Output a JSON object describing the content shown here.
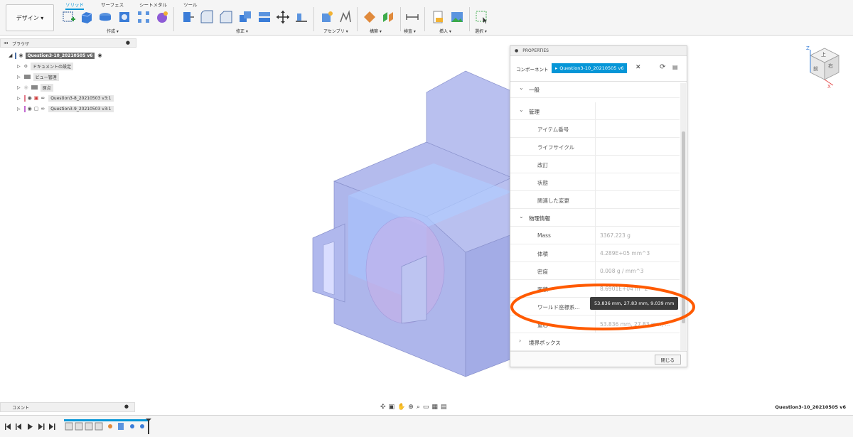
{
  "toolbar": {
    "workspace_label": "デザイン ▾",
    "tabs": [
      "ソリッド",
      "サーフェス",
      "シートメタル",
      "ツール"
    ],
    "groups": [
      "作成 ▾",
      "修正 ▾",
      "アセンブリ ▾",
      "構築 ▾",
      "検査 ▾",
      "挿入 ▾",
      "選択 ▾"
    ]
  },
  "browser": {
    "title": "ブラウザ",
    "root": "Question3-10_20210505 v6",
    "items": [
      "ドキュメントの設定",
      "ビュー管理",
      "原点",
      "Question3-8_20210503 v3:1",
      "Question3-9_20210503 v3:1"
    ]
  },
  "properties": {
    "title": "PROPERTIES",
    "component_label": "コンポーネント",
    "component_name": "Question3-10_20210505 v6",
    "section_general": "一般",
    "section_manage": "管理",
    "manage_rows": [
      "アイテム番号",
      "ライフサイクル",
      "改訂",
      "状態",
      "関連した変更"
    ],
    "section_physical": "物理情報",
    "physical_rows": [
      {
        "label": "Mass",
        "value": "3367.223 g"
      },
      {
        "label": "体積",
        "value": "4.289E+05 mm^3"
      },
      {
        "label": "密度",
        "value": "0.008 g / mm^3"
      },
      {
        "label": "面積",
        "value": "8.6901E+04 m^2"
      },
      {
        "label": "ワールド座標系...",
        "value": ""
      },
      {
        "label": "重心",
        "value": "53.836 mm, 27.83 mm, ..."
      }
    ],
    "section_bbox": "境界ボックス",
    "close_label": "閉じる",
    "tooltip": "53.836 mm, 27.83 mm, 9.039 mm"
  },
  "comment": {
    "title": "コメント"
  },
  "viewcube": {
    "face_front": "前",
    "face_top": "上",
    "face_right": "右",
    "axis_z": "Z",
    "axis_x": "X"
  },
  "document_name": "Question3-10_20210505 v6",
  "colors": {
    "accent": "#0696d7",
    "highlight": "#ff5a00",
    "model": "#aab3ea"
  }
}
